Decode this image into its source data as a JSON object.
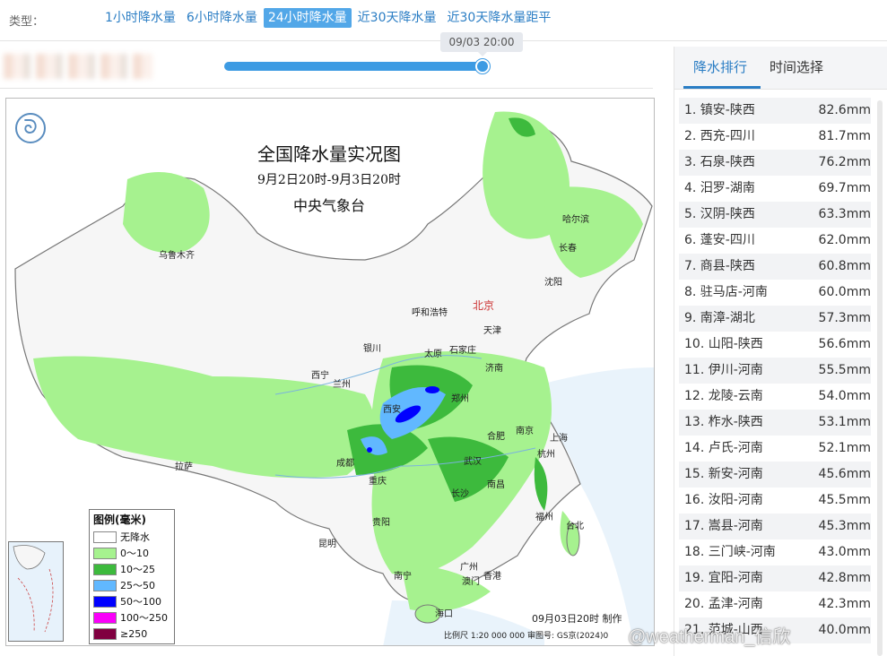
{
  "type_bar": {
    "label": "类型：",
    "tabs": [
      "1小时降水量",
      "6小时降水量",
      "24小时降水量",
      "近30天降水量",
      "近30天降水量距平"
    ],
    "active_index": 2
  },
  "slider": {
    "tooltip": "09/03 20:00",
    "progress": 1.0
  },
  "map": {
    "title": "全国降水量实况图",
    "subtitle": "9月2日20时-9月3日20时",
    "org": "中央气象台",
    "made": "09月03日20时 制作",
    "scale": "比例尺 1:20 000 000    审图号: GS京(2024)0",
    "cities": {
      "urumqi": "乌鲁木齐",
      "harbin": "哈尔滨",
      "changchun": "长春",
      "shenyang": "沈阳",
      "beijing": "北京",
      "tianjin": "天津",
      "hohhot": "呼和浩特",
      "yinchuan": "银川",
      "taiyuan": "太原",
      "shijiazhuang": "石家庄",
      "jinan": "济南",
      "xining": "西宁",
      "lanzhou": "兰州",
      "xian": "西安",
      "zhengzhou": "郑州",
      "nanjing": "南京",
      "hefei": "合肥",
      "shanghai": "上海",
      "hangzhou": "杭州",
      "wuhan": "武汉",
      "chengdu": "成都",
      "chongqing": "重庆",
      "lhasa": "拉萨",
      "changsha": "长沙",
      "nanchang": "南昌",
      "fuzhou": "福州",
      "guiyang": "贵阳",
      "kunming": "昆明",
      "nanning": "南宁",
      "guangzhou": "广州",
      "hongkong": "香港",
      "macau": "澳门",
      "taipei": "台北",
      "haikou": "海口"
    },
    "legend": {
      "title": "图例(毫米)",
      "items": [
        {
          "label": "无降水",
          "color": "#ffffff"
        },
        {
          "label": "0～10",
          "color": "#a6f28f"
        },
        {
          "label": "10～25",
          "color": "#3dba3d"
        },
        {
          "label": "25～50",
          "color": "#61b8ff"
        },
        {
          "label": "50～100",
          "color": "#0000ff"
        },
        {
          "label": "100～250",
          "color": "#fa00fa"
        },
        {
          "label": "≥250",
          "color": "#800040"
        }
      ]
    },
    "logo_glyph": "ᘐ"
  },
  "watermark": "@weatherman_信欣",
  "ranking": {
    "tabs": [
      "降水排行",
      "时间选择"
    ],
    "active_index": 0,
    "rows": [
      {
        "name": "1. 镇安-陕西",
        "value": "82.6mm"
      },
      {
        "name": "2. 西充-四川",
        "value": "81.7mm"
      },
      {
        "name": "3. 石泉-陕西",
        "value": "76.2mm"
      },
      {
        "name": "4. 汨罗-湖南",
        "value": "69.7mm"
      },
      {
        "name": "5. 汉阴-陕西",
        "value": "63.3mm"
      },
      {
        "name": "6. 蓬安-四川",
        "value": "62.0mm"
      },
      {
        "name": "7. 商县-陕西",
        "value": "60.8mm"
      },
      {
        "name": "8. 驻马店-河南",
        "value": "60.0mm"
      },
      {
        "name": "9. 南漳-湖北",
        "value": "57.3mm"
      },
      {
        "name": "10. 山阳-陕西",
        "value": "56.6mm"
      },
      {
        "name": "11. 伊川-河南",
        "value": "55.5mm"
      },
      {
        "name": "12. 龙陵-云南",
        "value": "54.0mm"
      },
      {
        "name": "13. 柞水-陕西",
        "value": "53.1mm"
      },
      {
        "name": "14. 卢氏-河南",
        "value": "52.1mm"
      },
      {
        "name": "15. 新安-河南",
        "value": "45.6mm"
      },
      {
        "name": "16. 汝阳-河南",
        "value": "45.5mm"
      },
      {
        "name": "17. 嵩县-河南",
        "value": "45.3mm"
      },
      {
        "name": "18. 三门峡-河南",
        "value": "43.0mm"
      },
      {
        "name": "19. 宜阳-河南",
        "value": "42.8mm"
      },
      {
        "name": "20. 孟津-河南",
        "value": "42.3mm"
      },
      {
        "name": "21. 范城-山西",
        "value": "40.0mm"
      }
    ]
  }
}
